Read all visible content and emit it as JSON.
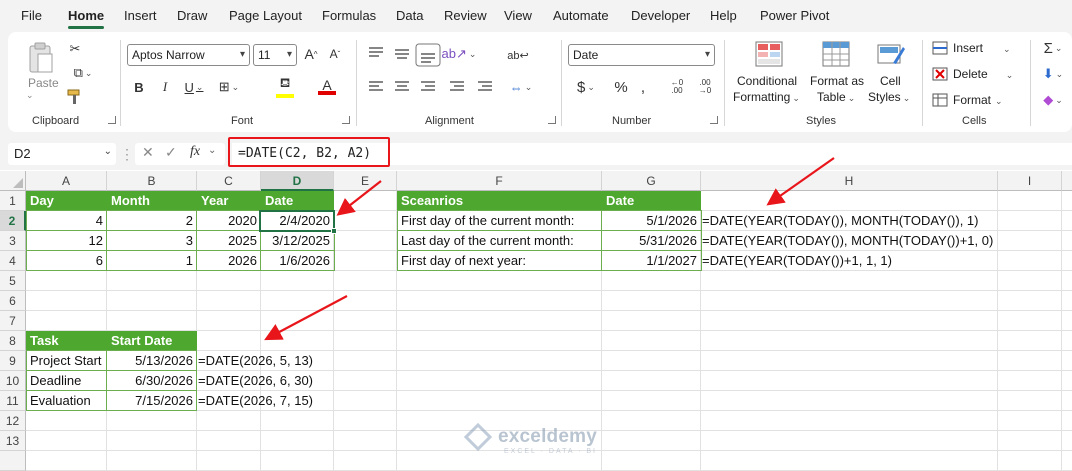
{
  "menu": {
    "tabs": [
      "File",
      "Home",
      "Insert",
      "Draw",
      "Page Layout",
      "Formulas",
      "Data",
      "Review",
      "View",
      "Automate",
      "Developer",
      "Help",
      "Power Pivot"
    ],
    "active": "Home"
  },
  "ribbon": {
    "clipboard": {
      "paste": "Paste",
      "label": "Clipboard"
    },
    "font": {
      "name": "Aptos Narrow",
      "size": "11",
      "label": "Font"
    },
    "alignment": {
      "label": "Alignment"
    },
    "number": {
      "format": "Date",
      "label": "Number"
    },
    "styles": {
      "conditional_line1": "Conditional",
      "conditional_line2": "Formatting",
      "format_as_line1": "Format as",
      "format_as_line2": "Table",
      "cell_styles_line1": "Cell",
      "cell_styles_line2": "Styles",
      "label": "Styles"
    },
    "cells": {
      "insert": "Insert",
      "delete": "Delete",
      "format": "Format",
      "label": "Cells"
    },
    "colors": {
      "highlight": "#ffff00",
      "font_color": "#e00000"
    }
  },
  "formula_bar": {
    "name_box": "D2",
    "fx": "fx",
    "formula": "=DATE(C2, B2, A2)"
  },
  "grid": {
    "columns": [
      "A",
      "B",
      "C",
      "D",
      "E",
      "F",
      "G",
      "H",
      "I"
    ],
    "selected_column": "D",
    "rows": [
      "1",
      "2",
      "3",
      "4",
      "5",
      "6",
      "7",
      "8",
      "9",
      "10",
      "11",
      "12",
      "13"
    ],
    "selected_row": "2"
  },
  "table1": {
    "headers": [
      "Day",
      "Month",
      "Year",
      "Date"
    ],
    "rows": [
      [
        "4",
        "2",
        "2020",
        "2/4/2020"
      ],
      [
        "12",
        "3",
        "2025",
        "3/12/2025"
      ],
      [
        "6",
        "1",
        "2026",
        "1/6/2026"
      ]
    ]
  },
  "table2": {
    "headers": [
      "Sceanrios",
      "Date"
    ],
    "rows": [
      [
        "First day of the current month:",
        "5/1/2026",
        "=DATE(YEAR(TODAY()), MONTH(TODAY()), 1)"
      ],
      [
        "Last day of the current month:",
        "5/31/2026",
        "=DATE(YEAR(TODAY()), MONTH(TODAY())+1, 0)"
      ],
      [
        "First day of next year:",
        "1/1/2027",
        "=DATE(YEAR(TODAY())+1, 1, 1)"
      ]
    ]
  },
  "table3": {
    "headers": [
      "Task",
      "Start Date"
    ],
    "rows": [
      [
        "Project Start",
        "5/13/2026",
        "=DATE(2026, 5, 13)"
      ],
      [
        "Deadline",
        "6/30/2026",
        "=DATE(2026, 6, 30)"
      ],
      [
        "Evaluation",
        "7/15/2026",
        "=DATE(2026, 7, 15)"
      ]
    ]
  },
  "watermark": {
    "name": "exceldemy",
    "tagline": "EXCEL · DATA · BI"
  },
  "colors": {
    "table_header": "#4ea72e",
    "accent": "#217346",
    "annotation": "#e8161b"
  }
}
